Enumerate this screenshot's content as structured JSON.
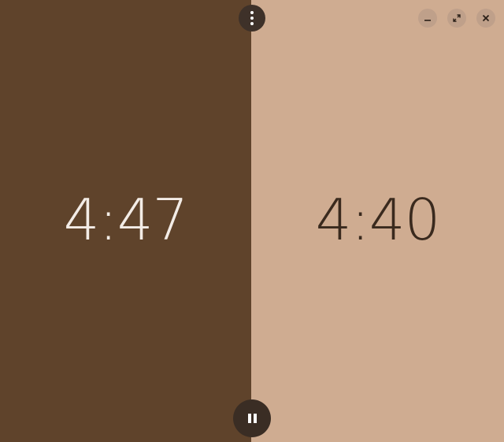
{
  "players": {
    "left": {
      "time": "4:47",
      "active": true
    },
    "right": {
      "time": "4:40",
      "active": false
    }
  },
  "icons": {
    "menu": "vertical-ellipsis-icon",
    "pause": "pause-icon",
    "minimize": "minimize-icon",
    "maximize": "maximize-icon",
    "close": "close-icon"
  },
  "colors": {
    "left_panel": "#5f432b",
    "right_panel": "#cfac91",
    "left_text": "#f3ece6",
    "right_text": "#3a2a1e",
    "overlay_button": "#3a2d24"
  }
}
